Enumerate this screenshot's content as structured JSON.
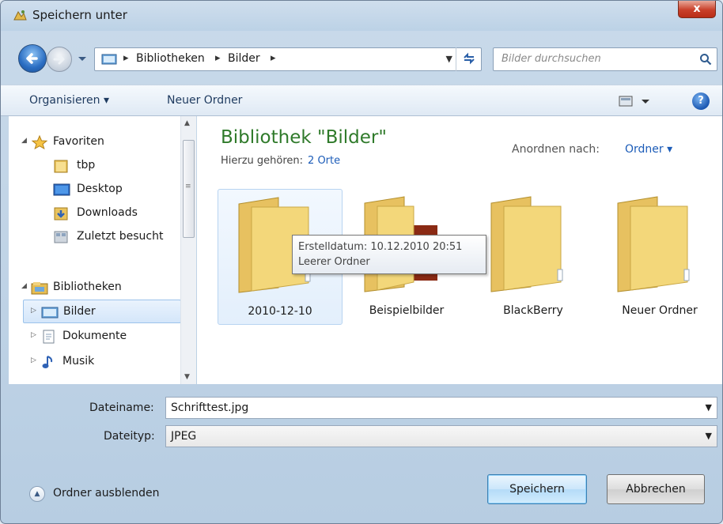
{
  "window": {
    "title": "Speichern unter",
    "close_label": "x"
  },
  "address": {
    "crumbs": [
      "Bibliotheken",
      "Bilder"
    ],
    "search_placeholder": "Bilder durchsuchen"
  },
  "toolbar": {
    "organize": "Organisieren ▾",
    "new_folder": "Neuer Ordner",
    "help": "?"
  },
  "nav": {
    "favorites_header": "Favoriten",
    "favorites": [
      "tbp",
      "Desktop",
      "Downloads",
      "Zuletzt besucht"
    ],
    "libraries_header": "Bibliotheken",
    "libraries": [
      "Bilder",
      "Dokumente",
      "Musik"
    ],
    "selected": "Bilder"
  },
  "content": {
    "title": "Bibliothek \"Bilder\"",
    "subtitle": "Hierzu gehören:",
    "locations_link": "2 Orte",
    "sort_label": "Anordnen nach:",
    "sort_value": "Ordner ▾",
    "items": [
      {
        "name": "2010-12-10",
        "has_preview": false
      },
      {
        "name": "Beispielbilder",
        "has_preview": true
      },
      {
        "name": "BlackBerry",
        "has_preview": false
      },
      {
        "name": "Neuer Ordner",
        "has_preview": false
      }
    ],
    "tooltip": {
      "line1": "Erstelldatum: 10.12.2010 20:51",
      "line2": "Leerer Ordner"
    }
  },
  "form": {
    "filename_label": "Dateiname:",
    "filename_value": "Schrifttest.jpg",
    "filetype_label": "Dateityp:",
    "filetype_value": "JPEG",
    "hide_folders": "Ordner ausblenden",
    "save": "Speichern",
    "cancel": "Abbrechen"
  },
  "colors": {
    "library_title": "#2f7a2a",
    "link": "#1c5cb8",
    "folder": "#f3d77a"
  }
}
